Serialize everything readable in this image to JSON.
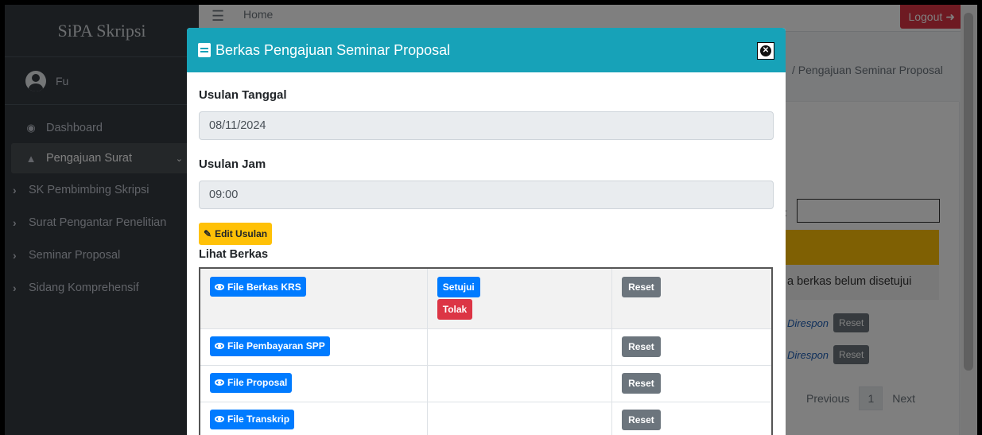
{
  "sidebar": {
    "brand": "SiPA Skripsi",
    "user_name": "Fu",
    "items": [
      {
        "label": "Dashboard"
      },
      {
        "label": "Pengajuan Surat"
      }
    ],
    "sub_items": [
      {
        "label": "SK Pembimbing Skripsi"
      },
      {
        "label": "Surat Pengantar Penelitian"
      },
      {
        "label": "Seminar Proposal"
      },
      {
        "label": "Sidang Komprehensif"
      }
    ]
  },
  "navbar": {
    "home": "Home",
    "logout": "Logout"
  },
  "background": {
    "breadcrumb": "/ Pengajuan Seminar Proposal",
    "search_label": ":",
    "grey_row_text": "a berkas belum disetujui",
    "resp_rows": [
      {
        "text": "Direspon",
        "reset": "Reset"
      },
      {
        "text": "Direspon",
        "reset": "Reset"
      }
    ],
    "pager": {
      "previous": "Previous",
      "current": "1",
      "next": "Next"
    }
  },
  "modal": {
    "title": "Berkas Pengajuan Seminar Proposal",
    "tanggal_label": "Usulan Tanggal",
    "tanggal_value": "08/11/2024",
    "jam_label": "Usulan Jam",
    "jam_value": "09:00",
    "edit_label": "Edit Usulan",
    "lihat_label": "Lihat Berkas",
    "rows": [
      {
        "file": "File Berkas KRS",
        "approve": "Setujui",
        "reject": "Tolak",
        "reset": "Reset"
      },
      {
        "file": "File Pembayaran SPP",
        "reset": "Reset"
      },
      {
        "file": "File Proposal",
        "reset": "Reset"
      },
      {
        "file": "File Transkrip",
        "reset": "Reset"
      }
    ]
  },
  "colors": {
    "modal_header": "#17a2b8",
    "sidebar": "#343a40",
    "primary": "#007bff",
    "danger": "#dc3545",
    "warning": "#ffc107",
    "secondary": "#6c757d"
  }
}
